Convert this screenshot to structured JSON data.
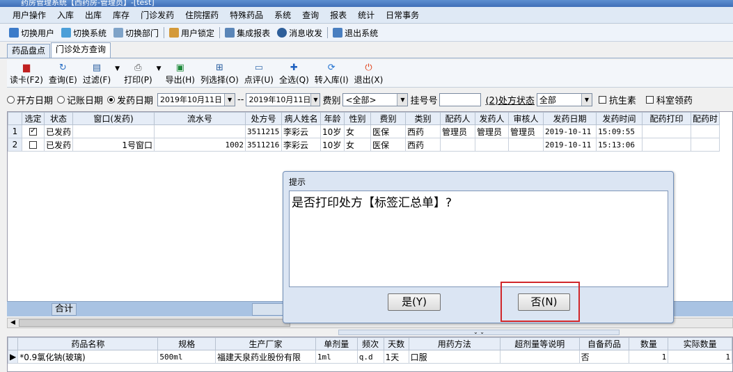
{
  "window": {
    "title": "药房管理系统【西药房-管理员】-[test]"
  },
  "menu": [
    "用户操作",
    "入库",
    "出库",
    "库存",
    "门诊发药",
    "住院摆药",
    "特殊药品",
    "系统",
    "查询",
    "报表",
    "统计",
    "日常事务"
  ],
  "quickbar": [
    "切换用户",
    "切换系统",
    "切换部门",
    "用户锁定",
    "集成报表",
    "消息收发",
    "退出系统"
  ],
  "tabs": [
    "药品盘点",
    "门诊处方查询"
  ],
  "toolbar": {
    "read_card": "读卡(F2)",
    "query": "查询(E)",
    "filter": "过滤(F)",
    "print": "打印(P)",
    "export": "导出(H)",
    "column_select": "列选择(O)",
    "review": "点评(U)",
    "select_all": "全选(Q)",
    "to_stock": "转入库(I)",
    "exit": "退出(X)"
  },
  "filters": {
    "radio_prescribe": "开方日期",
    "radio_account": "记账日期",
    "radio_dispense": "发药日期",
    "date_from": "2019年10月11日",
    "date_sep": "--",
    "date_to": "2019年10月11日",
    "fee_label": "费别",
    "fee_value": "<全部>",
    "reg_label": "挂号号",
    "status_label": "(2)处方状态",
    "status_value": "全部",
    "antibiotic_label": "抗生素",
    "dept_label": "科室领药"
  },
  "grid": {
    "columns": [
      "选定",
      "状态",
      "窗口(发药)",
      "流水号",
      "处方号",
      "病人姓名",
      "年龄",
      "性别",
      "费别",
      "类别",
      "配药人",
      "发药人",
      "审核人",
      "发药日期",
      "发药时间",
      "配药打印",
      "配药时"
    ],
    "rows": [
      {
        "no": "1",
        "checked": true,
        "status": "已发药",
        "window": "",
        "serial": "",
        "rx": "3511215",
        "name": "李彩云",
        "age": "10岁",
        "sex": "女",
        "fee": "医保",
        "cat": "西药",
        "prep": "管理员",
        "disp": "管理员",
        "audit": "管理员",
        "date": "2019-10-11",
        "time": "15:09:55"
      },
      {
        "no": "2",
        "checked": false,
        "status": "已发药",
        "window": "1号窗口",
        "serial": "1002",
        "rx": "3511216",
        "name": "李彩云",
        "age": "10岁",
        "sex": "女",
        "fee": "医保",
        "cat": "西药",
        "prep": "",
        "disp": "",
        "audit": "",
        "date": "2019-10-11",
        "time": "15:13:06"
      }
    ],
    "total_label": "合计"
  },
  "detail": {
    "columns": [
      "药品名称",
      "规格",
      "生产厂家",
      "单剂量",
      "频次",
      "天数",
      "用药方法",
      "超剂量等说明",
      "自备药品",
      "数量",
      "实际数量"
    ],
    "rows": [
      {
        "name": "*0.9氯化钠(玻璃)",
        "spec": "500ml",
        "maker": "福建天泉药业股份有限",
        "dose": "1ml",
        "freq": "q.d",
        "days": "1天",
        "method": "口服",
        "note": "",
        "own": "否",
        "qty": "1",
        "actual": "1"
      }
    ]
  },
  "dialog": {
    "title": "提示",
    "message": "是否打印处方【标签汇总单】?",
    "yes": "是(Y)",
    "no": "否(N)"
  },
  "colors": {
    "accent": "#d0262a",
    "header": "#e6edf7",
    "sum_row": "#a9c3e3"
  }
}
